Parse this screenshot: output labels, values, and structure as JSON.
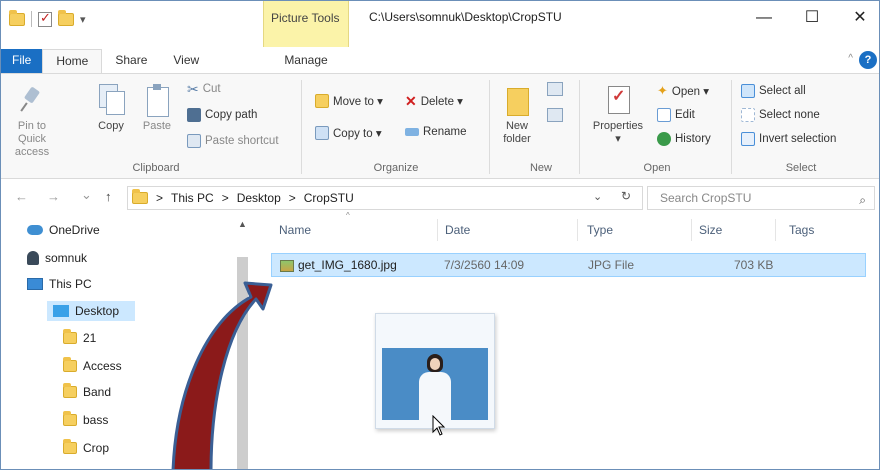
{
  "window": {
    "context_tab_label": "Picture Tools",
    "title_path": "C:\\Users\\somnuk\\Desktop\\CropSTU",
    "minimize": "—",
    "maximize": "☐",
    "close": "✕"
  },
  "tabs": {
    "file": "File",
    "home": "Home",
    "share": "Share",
    "view": "View",
    "manage": "Manage"
  },
  "ribbon": {
    "clipboard": {
      "pin_line1": "Pin to Quick",
      "pin_line2": "access",
      "copy": "Copy",
      "paste": "Paste",
      "cut": "Cut",
      "copy_path": "Copy path",
      "paste_shortcut": "Paste shortcut",
      "label": "Clipboard"
    },
    "organize": {
      "move_to": "Move to ▾",
      "copy_to": "Copy to ▾",
      "delete": "Delete ▾",
      "rename": "Rename",
      "label": "Organize"
    },
    "new": {
      "new_folder_line1": "New",
      "new_folder_line2": "folder",
      "label": "New"
    },
    "open": {
      "properties": "Properties",
      "properties_arrow": "▾",
      "open": "Open ▾",
      "edit": "Edit",
      "history": "History",
      "label": "Open"
    },
    "select": {
      "select_all": "Select all",
      "select_none": "Select none",
      "invert": "Invert selection",
      "label": "Select"
    }
  },
  "address": {
    "back": "←",
    "forward": "→",
    "recent": "⌄",
    "up": "↑",
    "crumb_sep": ">",
    "crumbs": [
      "This PC",
      "Desktop",
      "CropSTU"
    ],
    "dropdown": "⌄",
    "refresh": "↻",
    "search_placeholder": "Search CropSTU",
    "search_icon": "⌕"
  },
  "nav": {
    "items": [
      "OneDrive",
      "somnuk",
      "This PC",
      "Desktop",
      "21",
      "Access",
      "Band",
      "bass",
      "Crop"
    ],
    "scroll_up": "▲"
  },
  "list": {
    "sort_caret": "^",
    "columns": [
      "Name",
      "Date",
      "Type",
      "Size",
      "Tags"
    ],
    "rows": [
      {
        "name": "get_IMG_1680.jpg",
        "date": "7/3/2560 14:09",
        "type": "JPG File",
        "size": "703 KB"
      }
    ]
  },
  "colors": {
    "accent": "#1a6fc4",
    "selection": "#cce8ff",
    "context_tab": "#fbf3a9",
    "arrow_fill": "#8b1a1a",
    "arrow_outline": "#3a5f95"
  },
  "icons": {
    "overlay_arrow": "curved-arrow-icon",
    "cursor": "mouse-cursor-icon"
  }
}
